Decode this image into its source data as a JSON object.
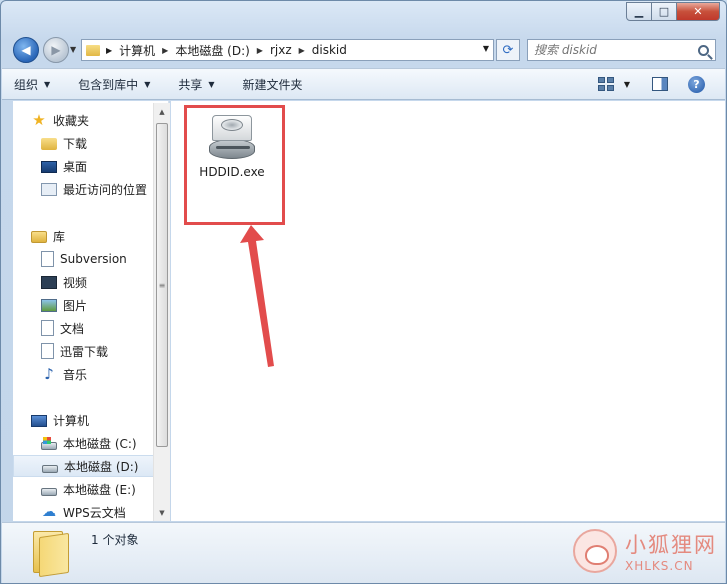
{
  "window": {
    "caption_min": "▁",
    "caption_max": "□",
    "caption_close": "✕"
  },
  "address": {
    "crumbs": [
      "计算机",
      "本地磁盘 (D:)",
      "rjxz",
      "diskid"
    ]
  },
  "search": {
    "placeholder": "搜索 diskid"
  },
  "toolbar": {
    "organize": "组织",
    "include_library": "包含到库中",
    "share": "共享",
    "new_folder": "新建文件夹"
  },
  "navpane": {
    "favorites": {
      "label": "收藏夹",
      "items": [
        "下载",
        "桌面",
        "最近访问的位置"
      ]
    },
    "libraries": {
      "label": "库",
      "items": [
        "Subversion",
        "视频",
        "图片",
        "文档",
        "迅雷下载",
        "音乐"
      ]
    },
    "computer": {
      "label": "计算机",
      "items": [
        "本地磁盘 (C:)",
        "本地磁盘 (D:)",
        "本地磁盘 (E:)",
        "WPS云文档"
      ],
      "selected": "本地磁盘 (D:)"
    }
  },
  "content": {
    "files": [
      {
        "name": "HDDID.exe",
        "icon": "hard-drive-icon"
      }
    ],
    "annotation_color": "#e24c4c"
  },
  "status": {
    "text": "1 个对象"
  },
  "watermark": {
    "cn": "小狐狸网",
    "en": "XHLKS.CN"
  }
}
